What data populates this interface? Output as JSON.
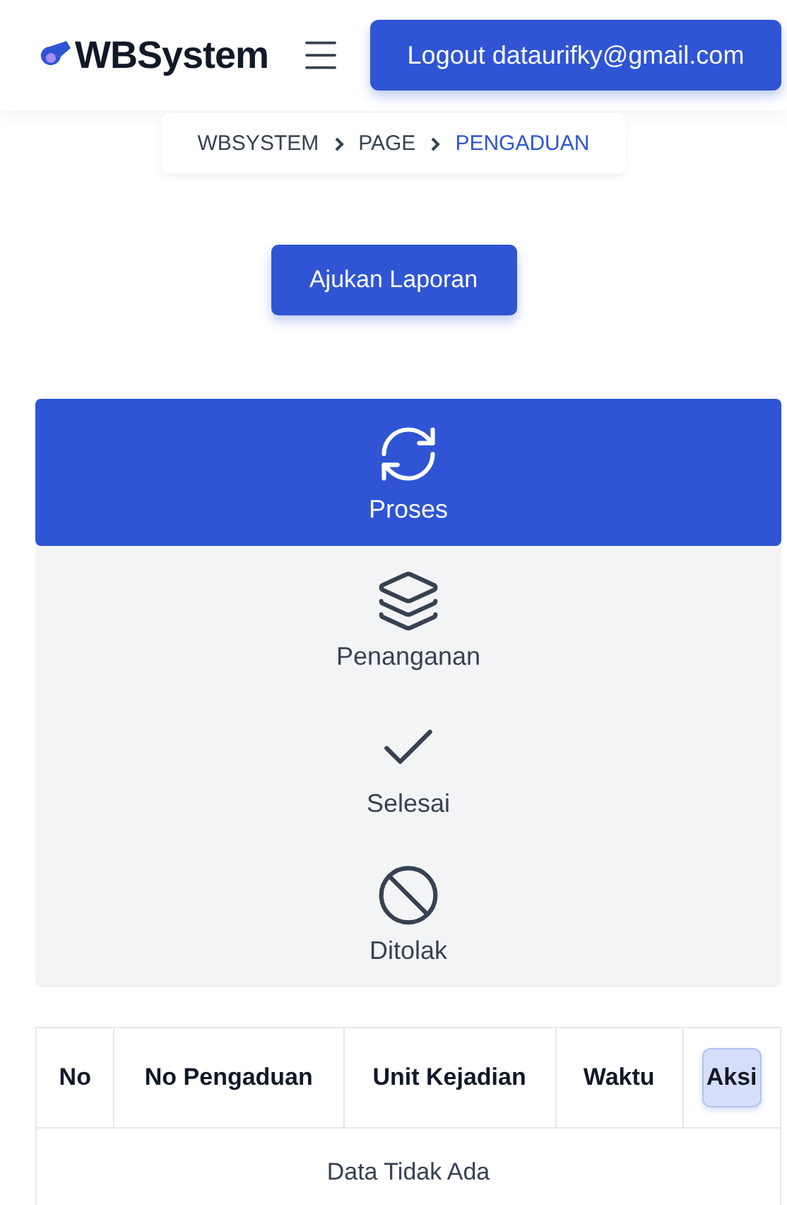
{
  "header": {
    "brand": "WBSystem",
    "logout_button": "Logout dataurifky@gmail.com"
  },
  "breadcrumb": [
    {
      "label": "WBSYSTEM",
      "current": false
    },
    {
      "label": "PAGE",
      "current": false
    },
    {
      "label": "PENGADUAN",
      "current": true
    }
  ],
  "submit_button": "Ajukan Laporan",
  "status_tabs": [
    {
      "kind": "refresh",
      "label": "Proses",
      "selected": true
    },
    {
      "kind": "layers",
      "label": "Penanganan",
      "selected": false
    },
    {
      "kind": "check",
      "label": "Selesai",
      "selected": false
    },
    {
      "kind": "ban",
      "label": "Ditolak",
      "selected": false
    }
  ],
  "table": {
    "columns": [
      {
        "label": "No",
        "highlighted": false
      },
      {
        "label": "No Pengaduan",
        "highlighted": false
      },
      {
        "label": "Unit Kejadian",
        "highlighted": false
      },
      {
        "label": "Waktu",
        "highlighted": false
      },
      {
        "label": "Aksi",
        "highlighted": true
      }
    ],
    "empty_message": "Data Tidak Ada"
  }
}
